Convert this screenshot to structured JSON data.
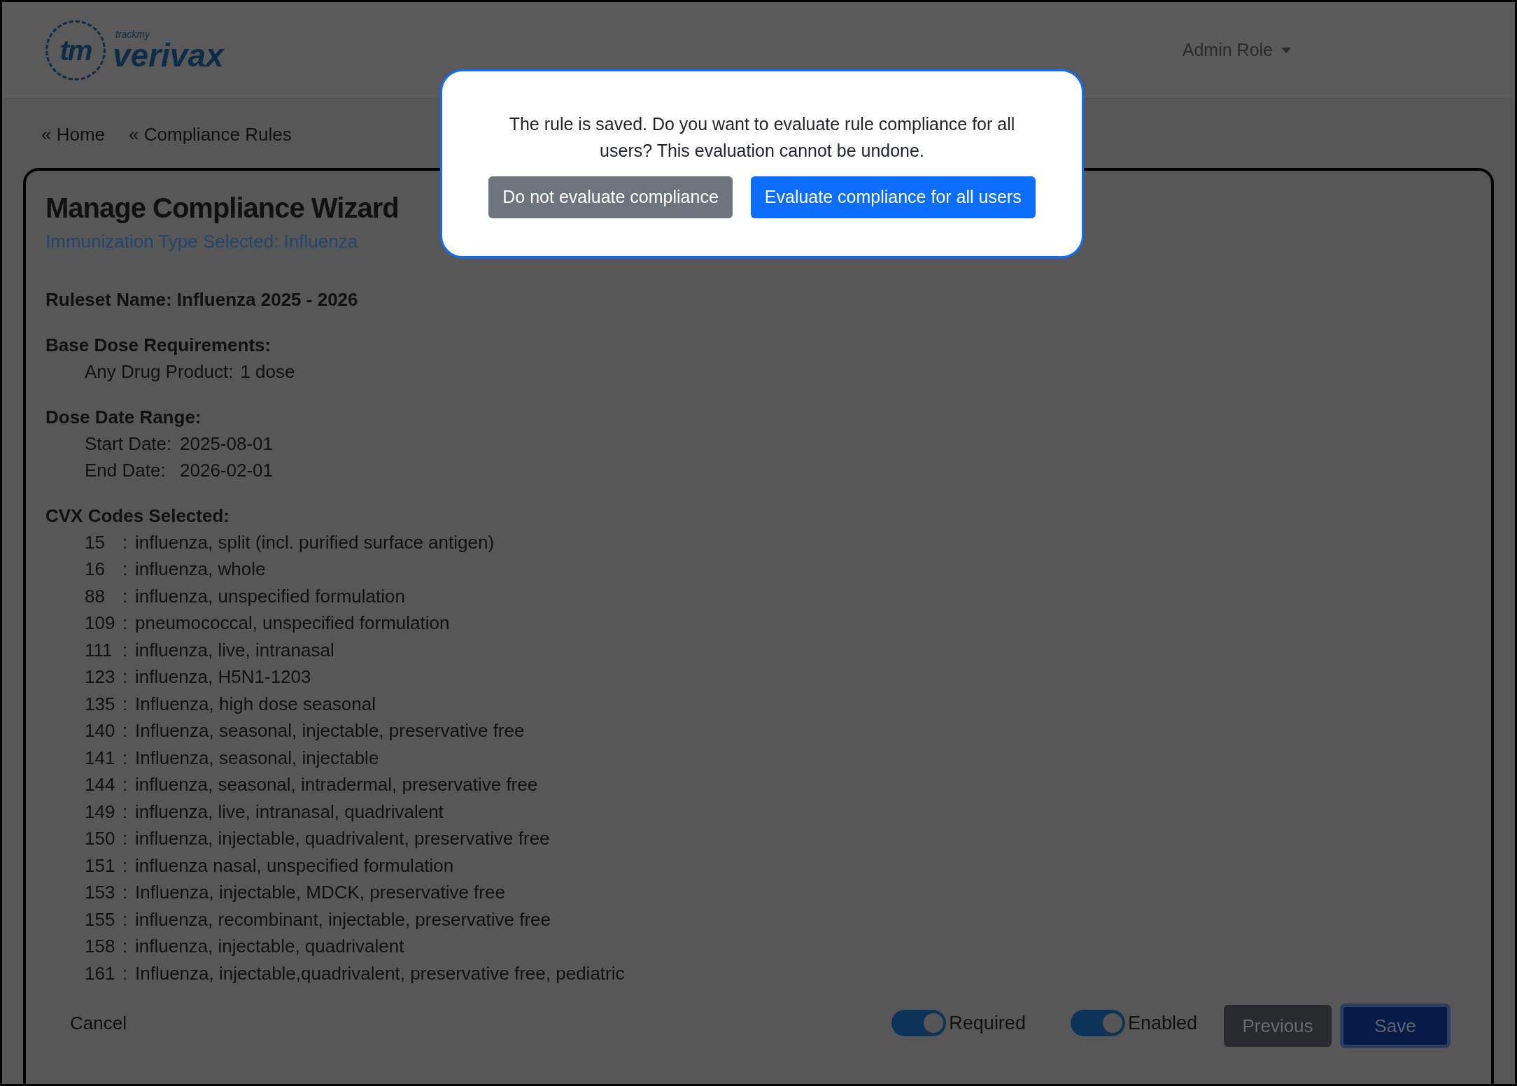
{
  "header": {
    "logo_mark": "tm",
    "logo_small": "trackmy",
    "logo_main": "verivax",
    "user_menu": "Admin Role"
  },
  "breadcrumbs": [
    "« Home",
    "« Compliance Rules"
  ],
  "wizard": {
    "title": "Manage Compliance Wizard",
    "subtitle": "Immunization Type Selected: Influenza",
    "ruleset": "Ruleset Name: Influenza 2025 - 2026",
    "base_dose": {
      "heading": "Base Dose Requirements:",
      "lines": [
        {
          "label": "Any Drug Product:",
          "value": "1 dose"
        }
      ]
    },
    "date_range": {
      "heading": "Dose Date Range:",
      "lines": [
        {
          "label": "Start Date:",
          "value": "2025-08-01"
        },
        {
          "label": "End Date:",
          "value": "2026-02-01"
        }
      ]
    },
    "cvx": {
      "heading": "CVX Codes Selected:",
      "separator": ":",
      "codes": [
        {
          "code": "15",
          "description": "influenza, split (incl. purified surface antigen)"
        },
        {
          "code": "16",
          "description": "influenza, whole"
        },
        {
          "code": "88",
          "description": "influenza, unspecified formulation"
        },
        {
          "code": "109",
          "description": "pneumococcal, unspecified formulation"
        },
        {
          "code": "111",
          "description": "influenza, live, intranasal"
        },
        {
          "code": "123",
          "description": "influenza, H5N1-1203"
        },
        {
          "code": "135",
          "description": "Influenza, high dose seasonal"
        },
        {
          "code": "140",
          "description": "Influenza, seasonal, injectable, preservative free"
        },
        {
          "code": "141",
          "description": "Influenza, seasonal, injectable"
        },
        {
          "code": "144",
          "description": "influenza, seasonal, intradermal, preservative free"
        },
        {
          "code": "149",
          "description": "influenza, live, intranasal, quadrivalent"
        },
        {
          "code": "150",
          "description": "influenza, injectable, quadrivalent, preservative free"
        },
        {
          "code": "151",
          "description": "influenza nasal, unspecified formulation"
        },
        {
          "code": "153",
          "description": "Influenza, injectable, MDCK, preservative free"
        },
        {
          "code": "155",
          "description": "influenza, recombinant, injectable, preservative free"
        },
        {
          "code": "158",
          "description": "influenza, injectable, quadrivalent"
        },
        {
          "code": "161",
          "description": "Influenza, injectable,quadrivalent, preservative free, pediatric"
        }
      ]
    }
  },
  "footer": {
    "cancel": "Cancel",
    "toggles": [
      {
        "label": "Required",
        "on": true
      },
      {
        "label": "Enabled",
        "on": true
      }
    ],
    "previous": "Previous",
    "save": "Save"
  },
  "dialog": {
    "message": "The rule is saved. Do you want to evaluate rule compliance for all users? This evaluation cannot be undone.",
    "buttons": [
      {
        "label": "Do not evaluate compliance",
        "kind": "secondary"
      },
      {
        "label": "Evaluate compliance for all users",
        "kind": "primary"
      }
    ]
  }
}
